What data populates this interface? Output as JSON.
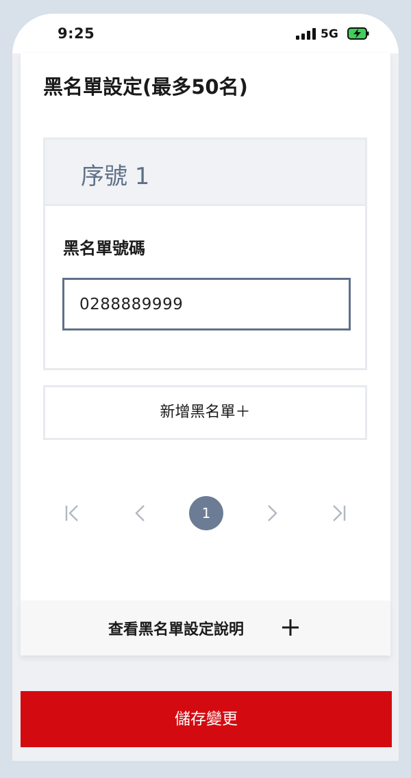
{
  "status_bar": {
    "time": "9:25",
    "network": "5G",
    "icons": [
      "signal-icon",
      "battery-charging-icon"
    ]
  },
  "page": {
    "title": "黑名單設定(最多50名)"
  },
  "entry": {
    "header_label": "序號 1",
    "field_label": "黑名單號碼",
    "number_value": "0288889999"
  },
  "add_button": {
    "label": "新增黑名單＋"
  },
  "pagination": {
    "current_page": "1",
    "icons": [
      "first-page-icon",
      "prev-page-icon",
      "next-page-icon",
      "last-page-icon"
    ]
  },
  "help": {
    "label": "查看黑名單設定說明",
    "icon": "plus-icon"
  },
  "save_button": {
    "label": "儲存變更"
  },
  "colors": {
    "accent_red": "#d30b11",
    "slate": "#5f7088",
    "page_badge": "#6c7c95",
    "border": "#e7eaee",
    "charge_green": "#3fcf5b"
  }
}
